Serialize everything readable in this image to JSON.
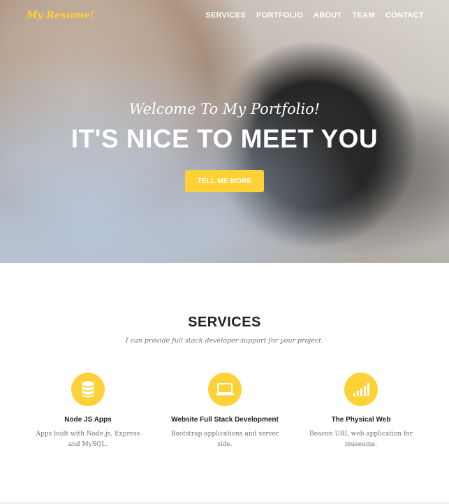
{
  "nav": {
    "brand": "My Resume!",
    "items": [
      "SERVICES",
      "PORTFOLIO",
      "ABOUT",
      "TEAM",
      "CONTACT"
    ]
  },
  "hero": {
    "lead": "Welcome To My Portfolio!",
    "heading": "IT'S NICE TO MEET YOU",
    "button_label": "TELL ME MORE"
  },
  "services": {
    "title": "SERVICES",
    "subtitle": "I can provide full stack developer support for your project.",
    "items": [
      {
        "icon": "database-icon",
        "title": "Node JS Apps",
        "text": "Apps built with Node.js, Express and MySQL."
      },
      {
        "icon": "laptop-icon",
        "title": "Website Full Stack Development",
        "text": "Bootstrap applications and server side."
      },
      {
        "icon": "signal-icon",
        "title": "The Physical Web",
        "text": "Beacon URL web application for museums."
      }
    ]
  },
  "colors": {
    "accent": "#fed136",
    "heading": "#222222",
    "muted": "#6c757d"
  }
}
